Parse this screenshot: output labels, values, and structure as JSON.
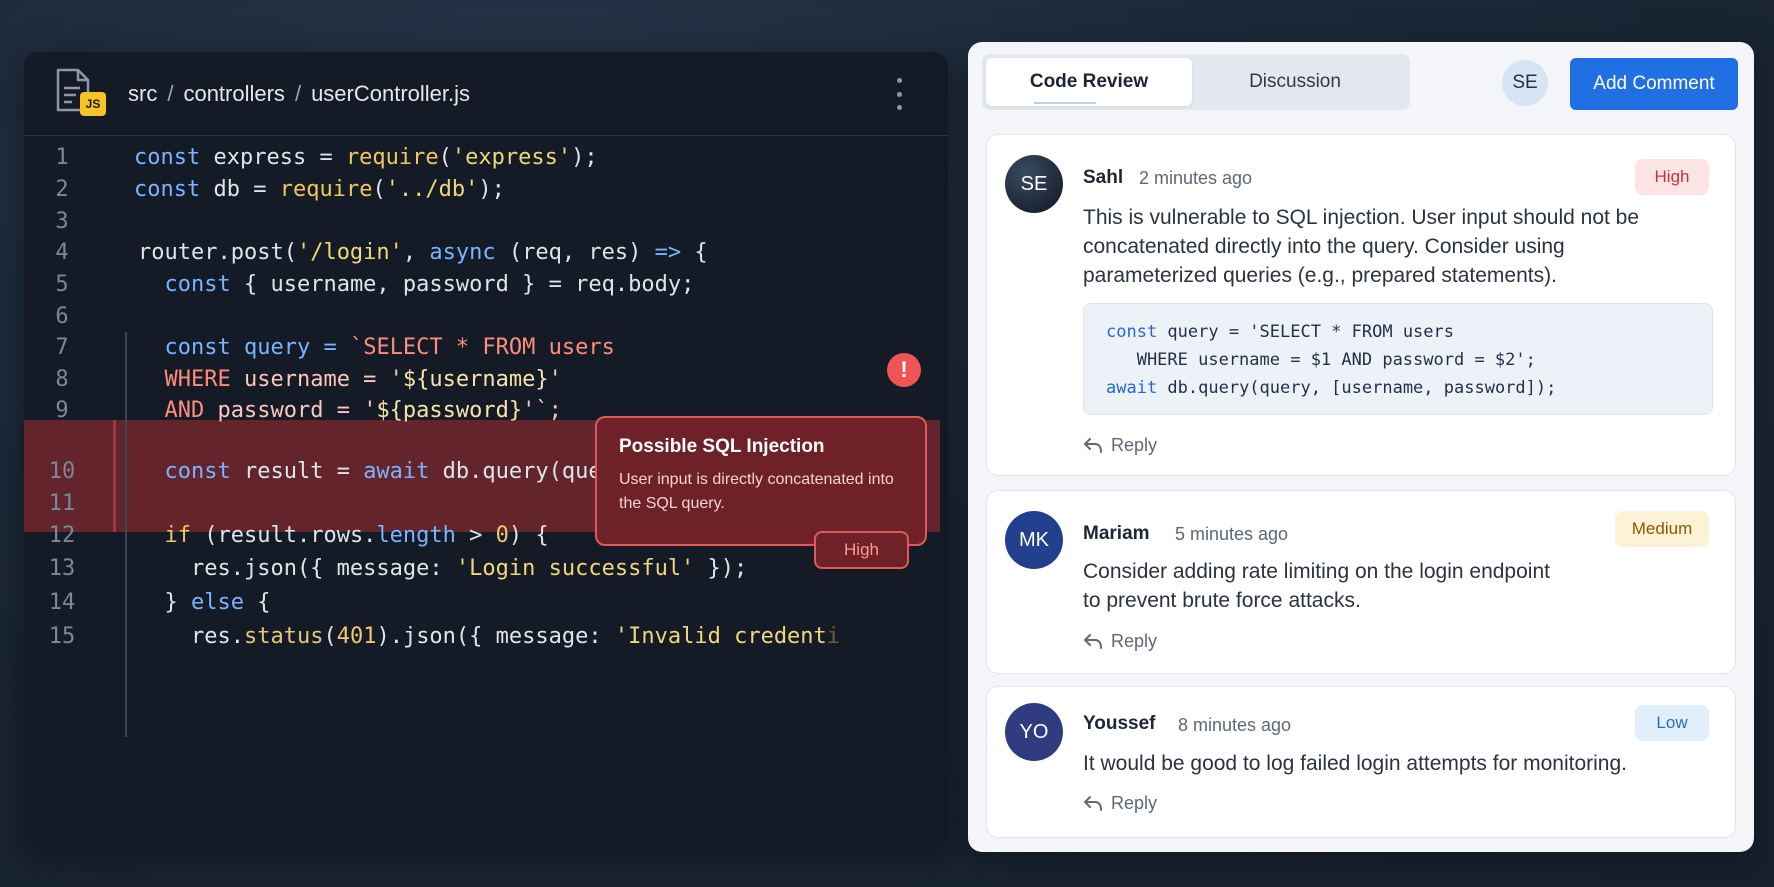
{
  "editor": {
    "breadcrumb": [
      "src",
      "controllers",
      "userController.js"
    ],
    "separator": "/",
    "file_badge": "JS",
    "lines": [
      {
        "n": "1",
        "tokens": [
          {
            "t": "const",
            "c": "kw"
          },
          {
            "t": " express = "
          },
          {
            "t": "require",
            "c": "kw2"
          },
          {
            "t": "("
          },
          {
            "t": "'express'",
            "c": "str"
          },
          {
            "t": ");"
          }
        ]
      },
      {
        "n": "2",
        "tokens": [
          {
            "t": "const",
            "c": "kw"
          },
          {
            "t": " db = "
          },
          {
            "t": "require",
            "c": "kw2"
          },
          {
            "t": "("
          },
          {
            "t": "'../db'",
            "c": "str"
          },
          {
            "t": ");"
          }
        ]
      },
      {
        "n": "3",
        "tokens": []
      },
      {
        "n": "4",
        "tokens": [
          {
            "t": "router.post("
          },
          {
            "t": "'/login'",
            "c": "str"
          },
          {
            "t": ", "
          },
          {
            "t": "async",
            "c": "kw"
          },
          {
            "t": " (req, res) "
          },
          {
            "t": "=>",
            "c": "kw"
          },
          {
            "t": " {"
          }
        ]
      },
      {
        "n": "5",
        "tokens": [
          {
            "t": "  "
          },
          {
            "t": "const",
            "c": "kw"
          },
          {
            "t": " { username, password } = req.body;"
          }
        ]
      },
      {
        "n": "6",
        "tokens": []
      },
      {
        "n": "7",
        "tokens": [
          {
            "t": "  "
          },
          {
            "t": "const",
            "c": "kw"
          },
          {
            "t": " query = ",
            "c": "kw"
          },
          {
            "t": "`SELECT * FROM users",
            "c": "sqlk"
          }
        ]
      },
      {
        "n": "8",
        "tokens": [
          {
            "t": "  "
          },
          {
            "t": "WHERE",
            "c": "sqlk"
          },
          {
            "t": " username = '",
            "c": "sqlv"
          },
          {
            "t": "${username}",
            "c": "interp"
          },
          {
            "t": "'",
            "c": "sqlv"
          }
        ]
      },
      {
        "n": "9",
        "tokens": [
          {
            "t": "  "
          },
          {
            "t": "AND",
            "c": "sqlk"
          },
          {
            "t": " password = '",
            "c": "sqlv"
          },
          {
            "t": "${password}",
            "c": "interp"
          },
          {
            "t": "'`;",
            "c": "sqlv"
          }
        ]
      },
      {
        "n": "10",
        "tokens": [
          {
            "t": "  "
          },
          {
            "t": "const",
            "c": "kw"
          },
          {
            "t": " result = "
          },
          {
            "t": "await",
            "c": "kw"
          },
          {
            "t": " db.query(query);"
          }
        ]
      },
      {
        "n": "11",
        "tokens": []
      },
      {
        "n": "12",
        "tokens": [
          {
            "t": "  "
          },
          {
            "t": "if",
            "c": "kw2"
          },
          {
            "t": " (result.rows."
          },
          {
            "t": "length",
            "c": "kw"
          },
          {
            "t": " > "
          },
          {
            "t": "0",
            "c": "num"
          },
          {
            "t": ") {"
          }
        ]
      },
      {
        "n": "13",
        "tokens": [
          {
            "t": "    res.json({ message: "
          },
          {
            "t": "'Login successful'",
            "c": "str"
          },
          {
            "t": " });"
          }
        ]
      },
      {
        "n": "14",
        "tokens": [
          {
            "t": "  } "
          },
          {
            "t": "else",
            "c": "kw"
          },
          {
            "t": " {"
          }
        ]
      },
      {
        "n": "15",
        "tokens": [
          {
            "t": "    res."
          },
          {
            "t": "status",
            "c": "prop"
          },
          {
            "t": "("
          },
          {
            "t": "401",
            "c": "num"
          },
          {
            "t": ").json({ message: "
          },
          {
            "t": "'Invalid credent",
            "c": "str"
          },
          {
            "t": "i",
            "c": "fade"
          }
        ]
      }
    ],
    "tooltip": {
      "icon": "!",
      "title": "Possible SQL Injection",
      "body": "User input is directly concatenated into the SQL query.",
      "severity": "High"
    }
  },
  "review": {
    "tabs": [
      "Code Review",
      "Discussion"
    ],
    "active_tab": "Code Review",
    "current_user_initials": "SE",
    "add_comment_label": "Add Comment",
    "comments": [
      {
        "initials": "SE",
        "author": "Sahl",
        "time": "2 minutes ago",
        "severity": "High",
        "text": "This is vulnerable to SQL injection. User input should not be concatenated directly into the query. Consider using parameterized queries (e.g., prepared statements).",
        "snippet": [
          [
            {
              "t": "const",
              "c": "k"
            },
            {
              "t": " query = 'SELECT * FROM users"
            }
          ],
          [
            {
              "t": "   WHERE username = $1 AND password = $2';"
            }
          ],
          [
            {
              "t": "await",
              "c": "k"
            },
            {
              "t": " db.query(query, [username, password]);"
            }
          ]
        ],
        "reply_label": "Reply",
        "avatar_color": "#1e2a3a"
      },
      {
        "initials": "MK",
        "author": "Mariam",
        "time": "5 minutes ago",
        "severity": "Medium",
        "text": "Consider adding rate limiting on the login endpoint to prevent brute force attacks.",
        "reply_label": "Reply",
        "avatar_color": "#23408f"
      },
      {
        "initials": "YO",
        "author": "Youssef",
        "time": "8 minutes ago",
        "severity": "Low",
        "text": "It would be good to log failed login attempts for monitoring.",
        "reply_label": "Reply",
        "avatar_color": "#2f3d80"
      }
    ]
  }
}
